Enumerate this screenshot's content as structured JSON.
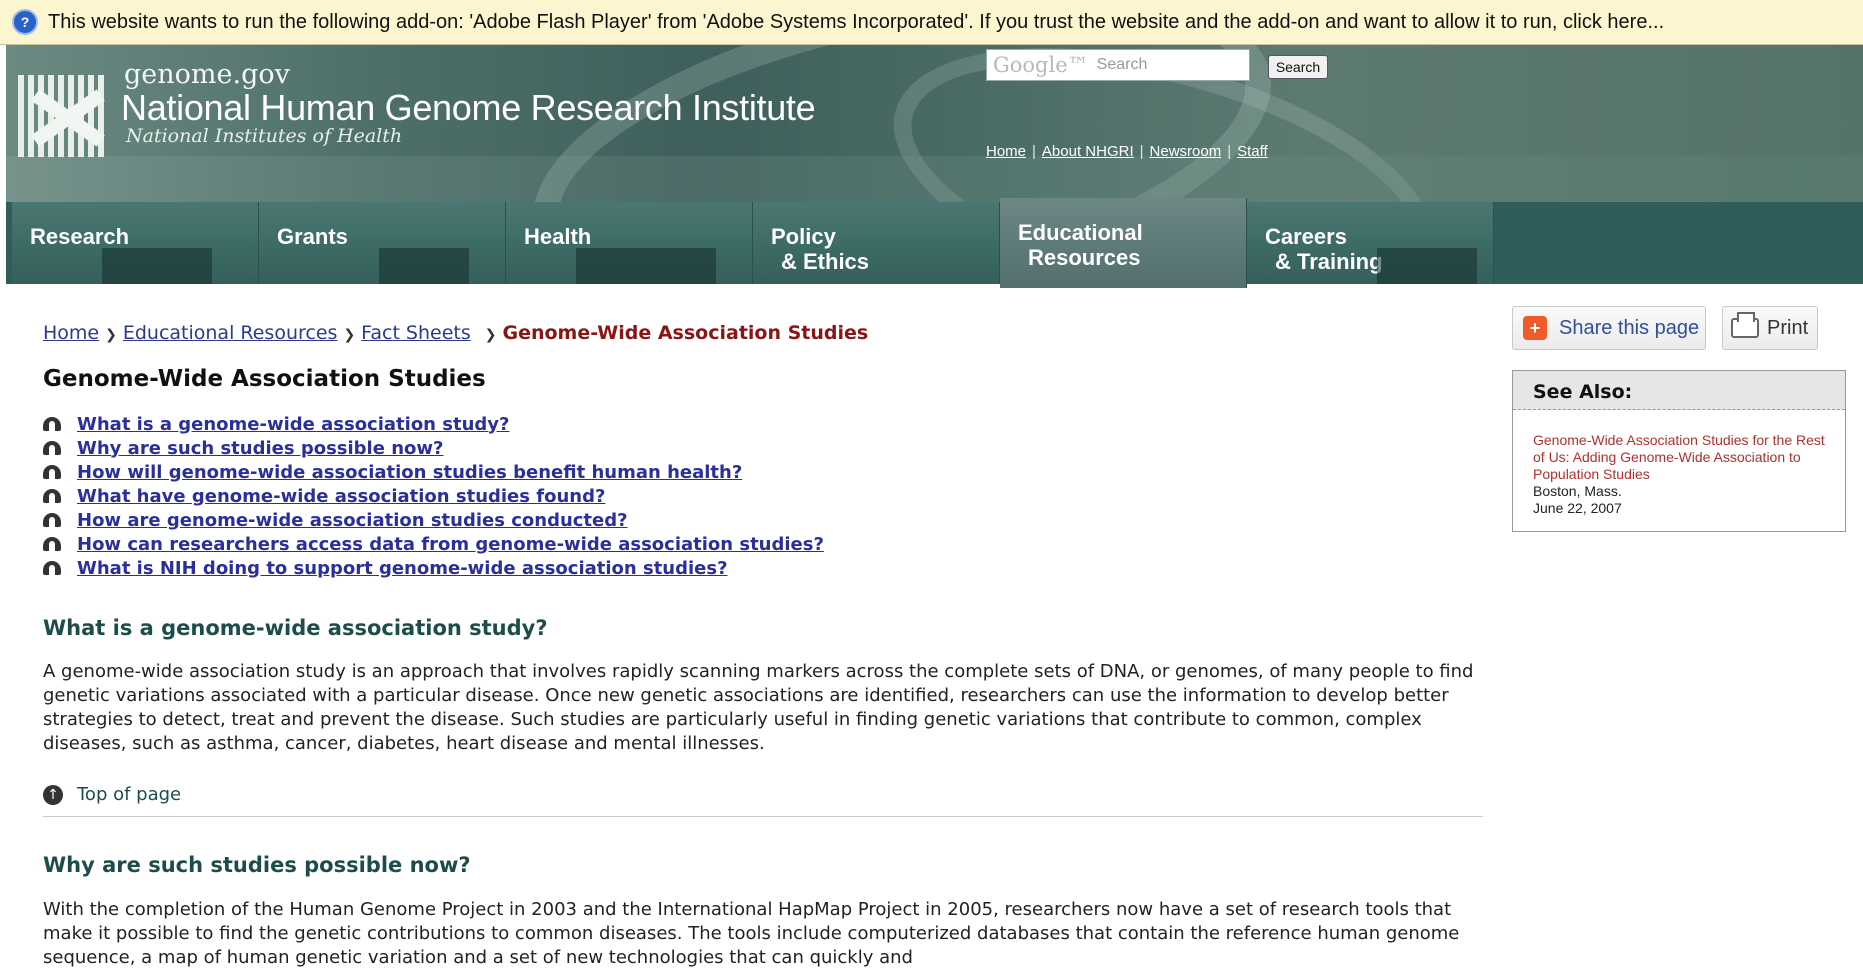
{
  "infobar": {
    "text": "This website wants to run the following add-on: 'Adobe Flash Player' from 'Adobe Systems Incorporated'. If you trust the website and the add-on and want to allow it to run, click here..."
  },
  "header": {
    "site_small": "genome.gov",
    "site_title": "National Human Genome Research Institute",
    "site_sub": "National Institutes of Health",
    "search": {
      "brand": "Google™",
      "placeholder": "Search",
      "button": "Search"
    },
    "toplinks": [
      "Home",
      "About NHGRI",
      "Newsroom",
      "Staff"
    ]
  },
  "nav": {
    "tabs": [
      {
        "line1": "Research",
        "line2": ""
      },
      {
        "line1": "Grants",
        "line2": ""
      },
      {
        "line1": "Health",
        "line2": ""
      },
      {
        "line1": "Policy",
        "line2": "& Ethics"
      },
      {
        "line1": "Educational",
        "line2": "Resources"
      },
      {
        "line1": "Careers",
        "line2": "& Training"
      }
    ],
    "active_index": 4
  },
  "breadcrumb": {
    "items": [
      "Home",
      "Educational Resources",
      "Fact Sheets"
    ],
    "current": "Genome-Wide Association Studies"
  },
  "page_title": "Genome-Wide Association Studies",
  "toc": [
    "What is a genome-wide association study?",
    "Why are such studies possible now?",
    "How will genome-wide association studies benefit human health?",
    "What have genome-wide association studies found?",
    "How are genome-wide association studies conducted?",
    "How can researchers access data from genome-wide association studies?",
    "What is NIH doing to support genome-wide association studies?"
  ],
  "sections": [
    {
      "heading": "What is a genome-wide association study?",
      "body": "A genome-wide association study is an approach that involves rapidly scanning markers across the complete sets of DNA, or genomes, of many people to find genetic variations associated with a particular disease. Once new genetic associations are identified, researchers can use the information to develop better strategies to detect, treat and prevent the disease. Such studies are particularly useful in finding genetic variations that contribute to common, complex diseases, such as asthma, cancer, diabetes, heart disease and mental illnesses."
    },
    {
      "heading": "Why are such studies possible now?",
      "body": "With the completion of the Human Genome Project in 2003 and the International HapMap Project in 2005, researchers now have a set of research tools that make it possible to find the genetic contributions to common diseases. The tools include computerized databases that contain the reference human genome sequence, a map of human genetic variation and a set of new technologies that can quickly and"
    }
  ],
  "top_of_page": "Top of page",
  "sidebar": {
    "share_label": "Share this page",
    "print_label": "Print",
    "see_also": {
      "heading": "See Also:",
      "link": "Genome-Wide Association Studies for the Rest of Us: Adding Genome-Wide Association to Population Studies",
      "location": "Boston, Mass.",
      "date": "June 22, 2007"
    }
  },
  "colors": {
    "nav_bg": "#2f5d59",
    "heading_teal": "#1d4d4a",
    "link_blue": "#2b2f9a",
    "breadcrumb_current": "#8b1515",
    "infobar_bg": "#fbf6cf",
    "share_orange": "#f15a2b"
  }
}
